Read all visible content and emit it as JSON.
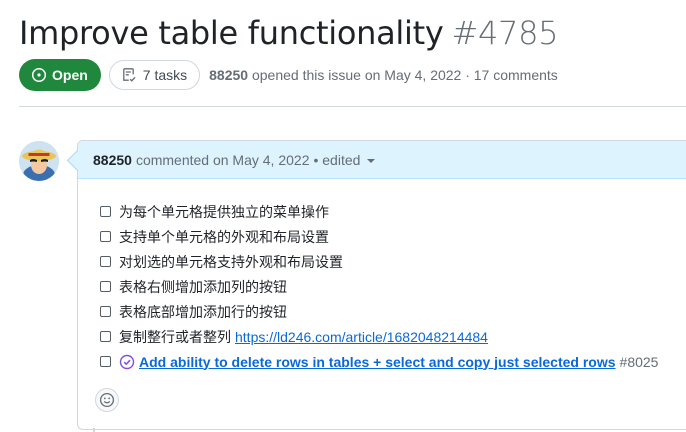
{
  "issue": {
    "title": "Improve table functionality",
    "number": "#4785",
    "state": "Open",
    "tasks": "7 tasks",
    "author": "88250",
    "opened_text": "opened this issue on May 4, 2022 · 17 comments"
  },
  "comment": {
    "author": "88250",
    "action": "commented on May 4, 2022",
    "edited": "• edited",
    "tasks": [
      {
        "text": "为每个单元格提供独立的菜单操作",
        "checked": false
      },
      {
        "text": "支持单个单元格的外观和布局设置",
        "checked": false
      },
      {
        "text": "对划选的单元格支持外观和布局设置",
        "checked": false
      },
      {
        "text": "表格右侧增加添加列的按钮",
        "checked": false
      },
      {
        "text": "表格底部增加添加行的按钮",
        "checked": false
      },
      {
        "text": "复制整行或者整列",
        "link": "https://ld246.com/article/1682048214484",
        "checked": false
      },
      {
        "issue_title": "Add ability to delete rows in tables + select and copy just selected rows",
        "issue_number": "#8025",
        "checked": false
      }
    ]
  },
  "icons": {
    "state": "issue-opened-icon",
    "tasks": "checklist-icon",
    "issue_ref": "issue-closed-icon",
    "reaction": "smiley-icon",
    "edited": "triangle-down-icon"
  },
  "colors": {
    "open_green": "#1f883d",
    "link_blue": "#0969da",
    "closed_purple": "#8250df",
    "header_bg": "#ddf4ff"
  }
}
